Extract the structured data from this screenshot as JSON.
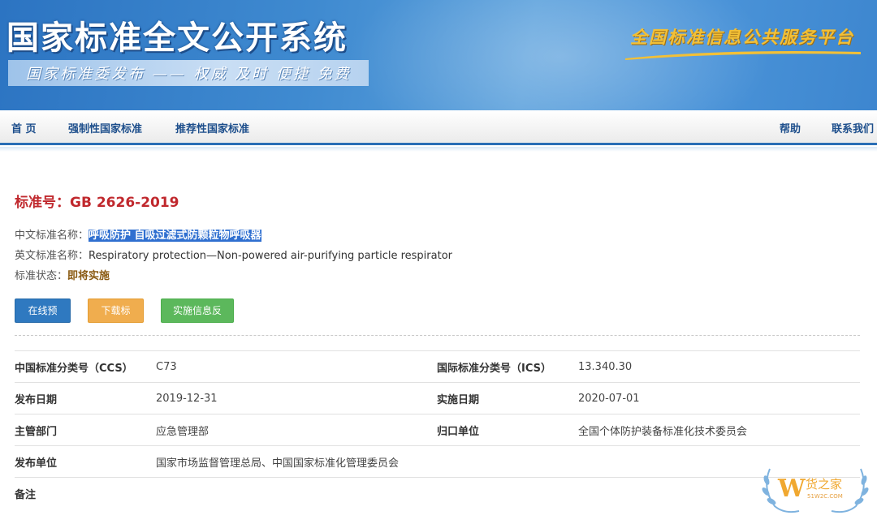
{
  "banner": {
    "title": "国家标准全文公开系统",
    "subtitle": "国家标准委发布 —— 权威 及时 便捷 免费",
    "right_slogan": "全国标准信息公共服务平台",
    "colors": {
      "bg": "#3f8ad0",
      "slogan": "#f2c037"
    }
  },
  "nav": {
    "home": "首 页",
    "mandatory": "强制性国家标准",
    "recommended": "推荐性国家标准",
    "help": "帮助",
    "contact": "联系我们"
  },
  "standard": {
    "number_label": "标准号：",
    "number": "GB 2626-2019",
    "cn_name_label": "中文标准名称：",
    "cn_name": "呼吸防护 自吸过滤式防颗粒物呼吸器",
    "en_name_label": "英文标准名称：",
    "en_name": "Respiratory protection—Non-powered air-purifying particle respirator",
    "status_label": "标准状态：",
    "status": "即将实施"
  },
  "buttons": {
    "preview": "在线预览",
    "download": "下载标准",
    "feedback": "实施信息反馈"
  },
  "details": {
    "ccs_label": "中国标准分类号（CCS）",
    "ccs": "C73",
    "ics_label": "国际标准分类号（ICS）",
    "ics": "13.340.30",
    "publish_date_label": "发布日期",
    "publish_date": "2019-12-31",
    "impl_date_label": "实施日期",
    "impl_date": "2020-07-01",
    "dept_label": "主管部门",
    "dept": "应急管理部",
    "org_label": "归口单位",
    "org": "全国个体防护装备标准化技术委员会",
    "publisher_label": "发布单位",
    "publisher": "国家市场监督管理总局、中国国家标准化管理委员会",
    "remark_label": "备注",
    "remark": ""
  },
  "watermark": {
    "brand": "货之家",
    "domain": "51W2C.COM",
    "letter": "W",
    "color": "#f0a830"
  }
}
